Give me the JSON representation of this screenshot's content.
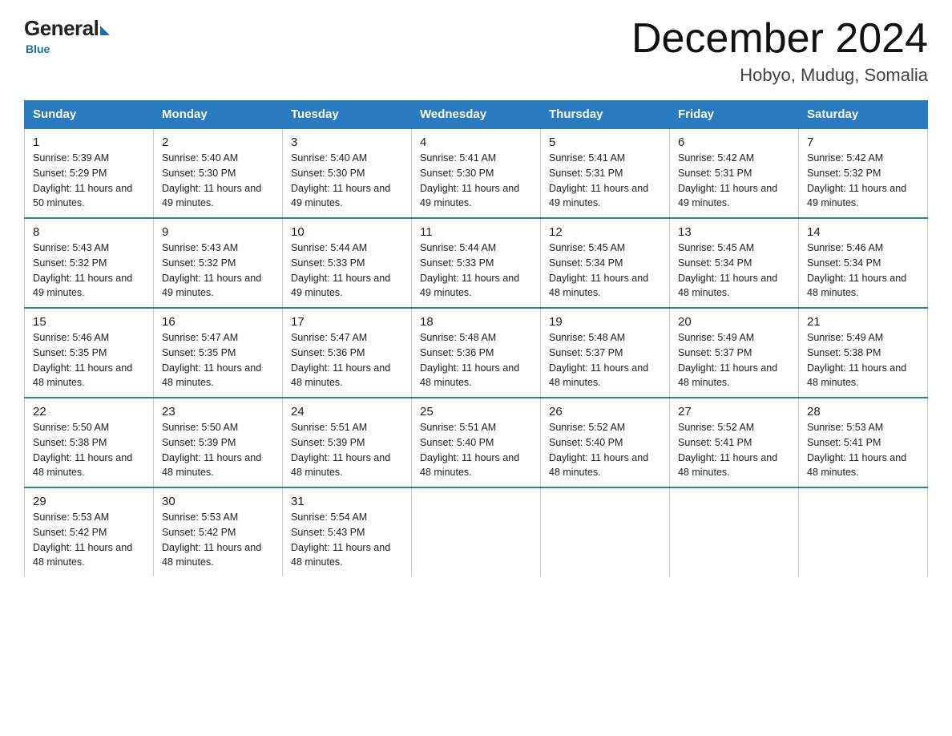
{
  "logo": {
    "general": "General",
    "blue": "Blue",
    "subtitle": "Blue"
  },
  "title": "December 2024",
  "location": "Hobyo, Mudug, Somalia",
  "days_of_week": [
    "Sunday",
    "Monday",
    "Tuesday",
    "Wednesday",
    "Thursday",
    "Friday",
    "Saturday"
  ],
  "weeks": [
    [
      {
        "day": "1",
        "sunrise": "5:39 AM",
        "sunset": "5:29 PM",
        "daylight": "11 hours and 50 minutes."
      },
      {
        "day": "2",
        "sunrise": "5:40 AM",
        "sunset": "5:30 PM",
        "daylight": "11 hours and 49 minutes."
      },
      {
        "day": "3",
        "sunrise": "5:40 AM",
        "sunset": "5:30 PM",
        "daylight": "11 hours and 49 minutes."
      },
      {
        "day": "4",
        "sunrise": "5:41 AM",
        "sunset": "5:30 PM",
        "daylight": "11 hours and 49 minutes."
      },
      {
        "day": "5",
        "sunrise": "5:41 AM",
        "sunset": "5:31 PM",
        "daylight": "11 hours and 49 minutes."
      },
      {
        "day": "6",
        "sunrise": "5:42 AM",
        "sunset": "5:31 PM",
        "daylight": "11 hours and 49 minutes."
      },
      {
        "day": "7",
        "sunrise": "5:42 AM",
        "sunset": "5:32 PM",
        "daylight": "11 hours and 49 minutes."
      }
    ],
    [
      {
        "day": "8",
        "sunrise": "5:43 AM",
        "sunset": "5:32 PM",
        "daylight": "11 hours and 49 minutes."
      },
      {
        "day": "9",
        "sunrise": "5:43 AM",
        "sunset": "5:32 PM",
        "daylight": "11 hours and 49 minutes."
      },
      {
        "day": "10",
        "sunrise": "5:44 AM",
        "sunset": "5:33 PM",
        "daylight": "11 hours and 49 minutes."
      },
      {
        "day": "11",
        "sunrise": "5:44 AM",
        "sunset": "5:33 PM",
        "daylight": "11 hours and 49 minutes."
      },
      {
        "day": "12",
        "sunrise": "5:45 AM",
        "sunset": "5:34 PM",
        "daylight": "11 hours and 48 minutes."
      },
      {
        "day": "13",
        "sunrise": "5:45 AM",
        "sunset": "5:34 PM",
        "daylight": "11 hours and 48 minutes."
      },
      {
        "day": "14",
        "sunrise": "5:46 AM",
        "sunset": "5:34 PM",
        "daylight": "11 hours and 48 minutes."
      }
    ],
    [
      {
        "day": "15",
        "sunrise": "5:46 AM",
        "sunset": "5:35 PM",
        "daylight": "11 hours and 48 minutes."
      },
      {
        "day": "16",
        "sunrise": "5:47 AM",
        "sunset": "5:35 PM",
        "daylight": "11 hours and 48 minutes."
      },
      {
        "day": "17",
        "sunrise": "5:47 AM",
        "sunset": "5:36 PM",
        "daylight": "11 hours and 48 minutes."
      },
      {
        "day": "18",
        "sunrise": "5:48 AM",
        "sunset": "5:36 PM",
        "daylight": "11 hours and 48 minutes."
      },
      {
        "day": "19",
        "sunrise": "5:48 AM",
        "sunset": "5:37 PM",
        "daylight": "11 hours and 48 minutes."
      },
      {
        "day": "20",
        "sunrise": "5:49 AM",
        "sunset": "5:37 PM",
        "daylight": "11 hours and 48 minutes."
      },
      {
        "day": "21",
        "sunrise": "5:49 AM",
        "sunset": "5:38 PM",
        "daylight": "11 hours and 48 minutes."
      }
    ],
    [
      {
        "day": "22",
        "sunrise": "5:50 AM",
        "sunset": "5:38 PM",
        "daylight": "11 hours and 48 minutes."
      },
      {
        "day": "23",
        "sunrise": "5:50 AM",
        "sunset": "5:39 PM",
        "daylight": "11 hours and 48 minutes."
      },
      {
        "day": "24",
        "sunrise": "5:51 AM",
        "sunset": "5:39 PM",
        "daylight": "11 hours and 48 minutes."
      },
      {
        "day": "25",
        "sunrise": "5:51 AM",
        "sunset": "5:40 PM",
        "daylight": "11 hours and 48 minutes."
      },
      {
        "day": "26",
        "sunrise": "5:52 AM",
        "sunset": "5:40 PM",
        "daylight": "11 hours and 48 minutes."
      },
      {
        "day": "27",
        "sunrise": "5:52 AM",
        "sunset": "5:41 PM",
        "daylight": "11 hours and 48 minutes."
      },
      {
        "day": "28",
        "sunrise": "5:53 AM",
        "sunset": "5:41 PM",
        "daylight": "11 hours and 48 minutes."
      }
    ],
    [
      {
        "day": "29",
        "sunrise": "5:53 AM",
        "sunset": "5:42 PM",
        "daylight": "11 hours and 48 minutes."
      },
      {
        "day": "30",
        "sunrise": "5:53 AM",
        "sunset": "5:42 PM",
        "daylight": "11 hours and 48 minutes."
      },
      {
        "day": "31",
        "sunrise": "5:54 AM",
        "sunset": "5:43 PM",
        "daylight": "11 hours and 48 minutes."
      },
      null,
      null,
      null,
      null
    ]
  ]
}
